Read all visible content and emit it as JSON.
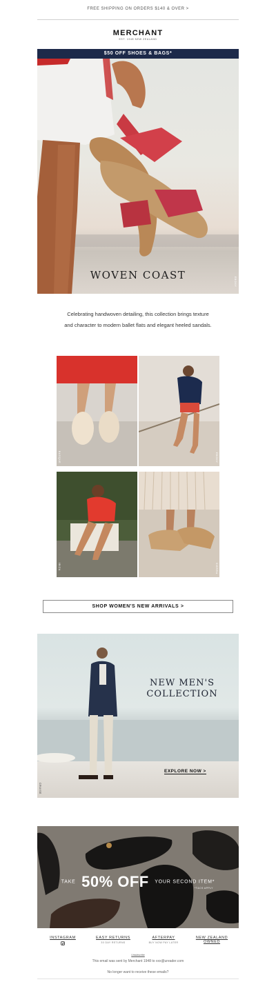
{
  "header": {
    "shipping_text": "FREE SHIPPING ON ORDERS $140 & OVER >",
    "logo": "MERCHANT",
    "logo_sub": "EST. 1948 NEW ZEALAND",
    "promo_banner": "$50 OFF SHOES & BAGS*"
  },
  "hero": {
    "title": "WOVEN COAST",
    "product_tag": "EBONY"
  },
  "intro": {
    "text": "Celebrating handwoven detailing, this collection brings texture and character to modern ballet flats and elegant heeled sandals."
  },
  "grid": {
    "tiles": [
      {
        "tag": "BASQUE"
      },
      {
        "tag": "EBONY"
      },
      {
        "tag": "IBIZA"
      },
      {
        "tag": "SIERRA"
      }
    ]
  },
  "cta": {
    "label": "SHOP WOMEN'S NEW ARRIVALS >"
  },
  "men": {
    "title_line1": "NEW MEN'S",
    "title_line2": "COLLECTION",
    "explore_label": "EXPLORE NOW >",
    "product_tag": "CRUISE"
  },
  "sale": {
    "prefix": "TAKE",
    "headline": "50% OFF",
    "suffix": "YOUR SECOND ITEM*",
    "note": "*T&CS APPLY"
  },
  "footer": {
    "links": [
      {
        "label": "INSTAGRAM",
        "sub": ""
      },
      {
        "label": "EASY RETURNS",
        "sub": "30 DAY RETURNS"
      },
      {
        "label": "AFTERPAY",
        "sub": "BUY NOW PAY LATER"
      },
      {
        "label": "NEW ZEALAND",
        "sub": "OWNED"
      }
    ],
    "unsubscribe_top": "Unsubscribe",
    "sent_text": "This email was sent by Merchant 1948 to xxx@ureader.com",
    "no_receive": "No longer want to receive these emails?"
  }
}
